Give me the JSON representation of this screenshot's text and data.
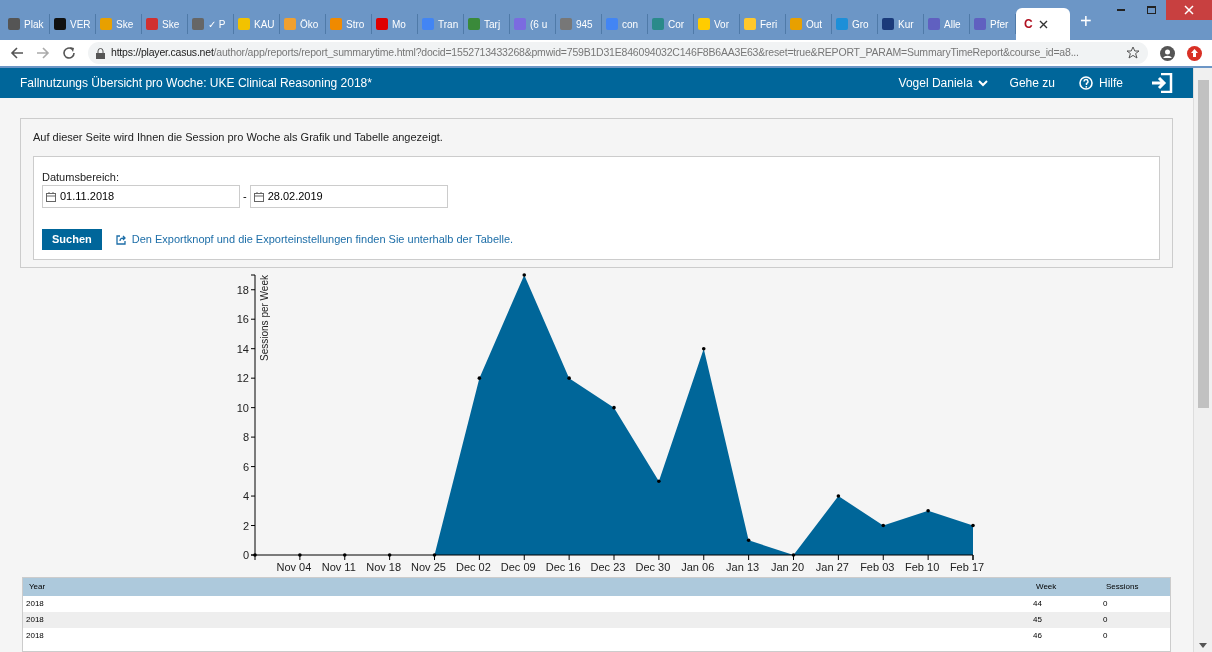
{
  "browser": {
    "tabs": [
      {
        "label": "Plak",
        "selected": false
      },
      {
        "label": "VER",
        "selected": false
      },
      {
        "label": "Ske",
        "selected": false
      },
      {
        "label": "Ske",
        "selected": false
      },
      {
        "label": "✓ P",
        "selected": false
      },
      {
        "label": "KAU",
        "selected": false
      },
      {
        "label": "Öko",
        "selected": false
      },
      {
        "label": "Stro",
        "selected": false
      },
      {
        "label": "Mo",
        "selected": false
      },
      {
        "label": "Tran",
        "selected": false
      },
      {
        "label": "Tarj",
        "selected": false
      },
      {
        "label": "(6 u",
        "selected": false
      },
      {
        "label": "945",
        "selected": false
      },
      {
        "label": "con",
        "selected": false
      },
      {
        "label": "Cor",
        "selected": false
      },
      {
        "label": "Vor",
        "selected": false
      },
      {
        "label": "Feri",
        "selected": false
      },
      {
        "label": "Out",
        "selected": false
      },
      {
        "label": "Gro",
        "selected": false
      },
      {
        "label": "Kur",
        "selected": false
      },
      {
        "label": "Alle",
        "selected": false
      },
      {
        "label": "Pfer",
        "selected": false
      },
      {
        "label": "C",
        "selected": true
      }
    ],
    "new_tab": "+",
    "url_host": "https://player.casus.net",
    "url_path": "/author/app/reports/report_summarytime.html?docid=1552713433268&pmwid=759B1D31E846094032C146F8B6AA3E63&reset=true&REPORT_PARAM=SummaryTimeReport&course_id=a8..."
  },
  "header": {
    "title": "Fallnutzungs Übersicht pro Woche: UKE Clinical Reasoning 2018*",
    "user": "Vogel Daniela",
    "goto": "Gehe zu",
    "help": "Hilfe"
  },
  "intro": "Auf dieser Seite wird Ihnen die Session pro Woche als Grafik und Tabelle angezeigt.",
  "filter": {
    "label": "Datumsbereich:",
    "from": "01.11.2018",
    "separator": "-",
    "to": "28.02.2019",
    "button": "Suchen",
    "export_hint": "Den Exportknopf und die Exporteinstellungen finden Sie unterhalb der Tabelle."
  },
  "chart_data": {
    "type": "area",
    "ylabel": "Sessions per Week",
    "categories": [
      null,
      "Nov 04",
      "Nov 11",
      "Nov 18",
      "Nov 25",
      "Dec 02",
      "Dec 09",
      "Dec 16",
      "Dec 23",
      "Dec 30",
      "Jan 06",
      "Jan 13",
      "Jan 20",
      "Jan 27",
      "Feb 03",
      "Feb 10",
      "Feb 17"
    ],
    "series": [
      {
        "color": "#006699",
        "values": [
          0,
          0,
          0,
          0,
          0,
          12,
          19,
          12,
          10,
          5,
          14,
          1,
          0,
          4,
          2,
          3,
          2
        ]
      }
    ],
    "ylim": [
      0,
      19
    ],
    "yticks": [
      0,
      2,
      4,
      6,
      8,
      10,
      12,
      14,
      16,
      18
    ]
  },
  "table": {
    "columns": [
      "Year",
      "Week",
      "Sessions"
    ],
    "rows": [
      [
        "2018",
        "44",
        "0"
      ],
      [
        "2018",
        "45",
        "0"
      ],
      [
        "2018",
        "46",
        "0"
      ]
    ]
  }
}
